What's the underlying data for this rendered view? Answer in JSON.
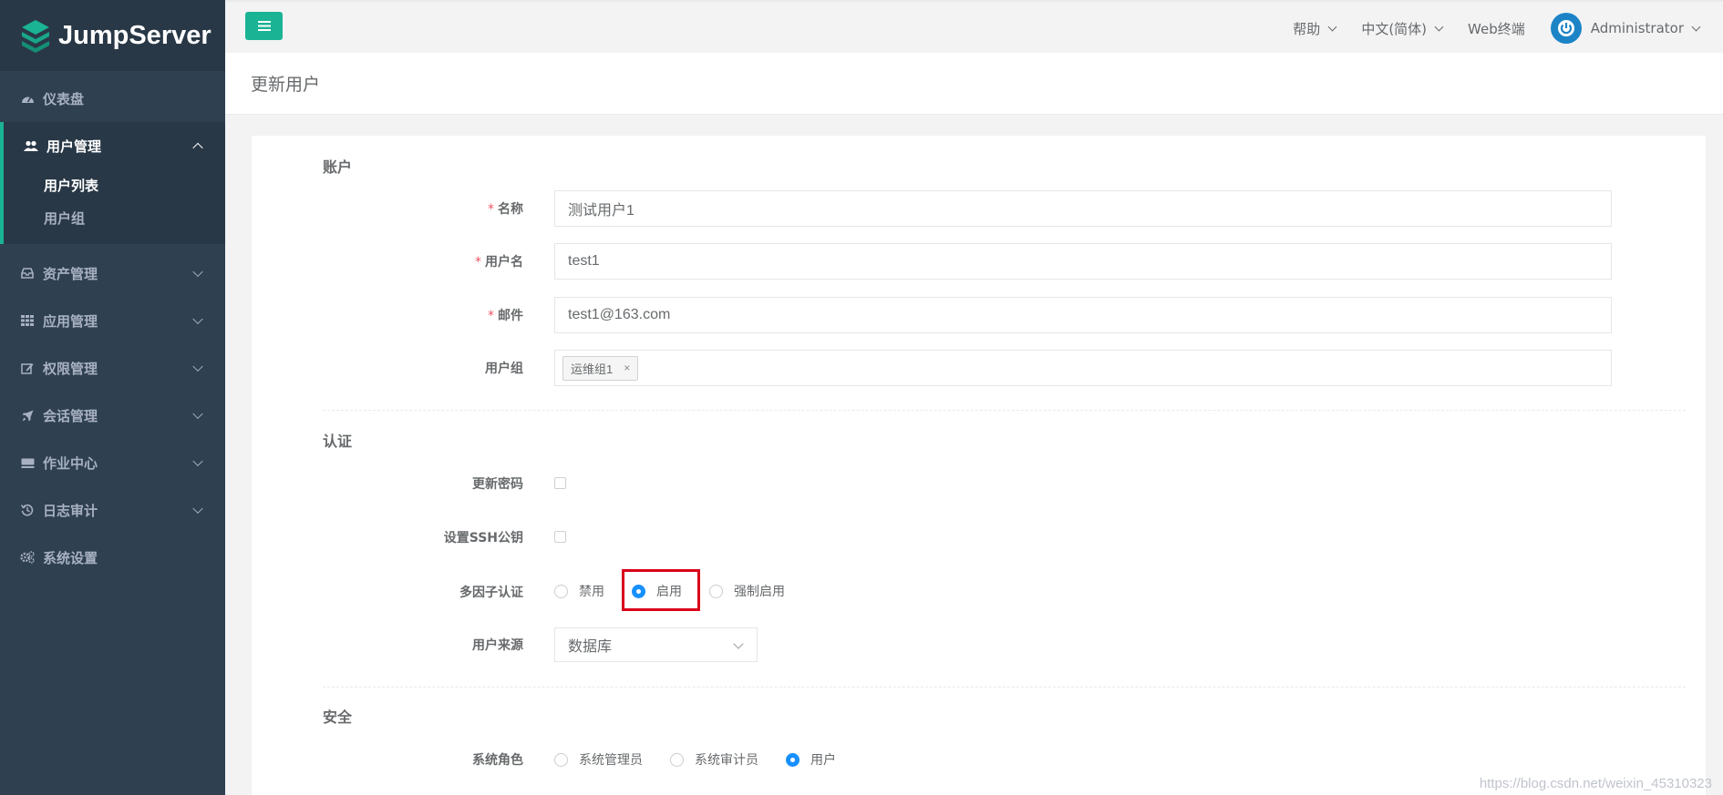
{
  "app": {
    "name": "JumpServer"
  },
  "sidebar": {
    "items": [
      {
        "label": "仪表盘",
        "icon": "dashboard-icon"
      },
      {
        "label": "用户管理",
        "icon": "users-icon",
        "expanded": true,
        "children": [
          {
            "label": "用户列表",
            "active": true
          },
          {
            "label": "用户组"
          }
        ]
      },
      {
        "label": "资产管理",
        "icon": "inbox-icon"
      },
      {
        "label": "应用管理",
        "icon": "grid-icon"
      },
      {
        "label": "权限管理",
        "icon": "edit-icon"
      },
      {
        "label": "会话管理",
        "icon": "rocket-icon"
      },
      {
        "label": "作业中心",
        "icon": "keyboard-icon"
      },
      {
        "label": "日志审计",
        "icon": "history-icon"
      },
      {
        "label": "系统设置",
        "icon": "gears-icon"
      }
    ]
  },
  "topbar": {
    "help": "帮助",
    "language": "中文(简体)",
    "web_terminal": "Web终端",
    "user": "Administrator"
  },
  "page": {
    "title": "更新用户"
  },
  "form": {
    "account_section": "账户",
    "name": {
      "label": "名称",
      "value": "测试用户1"
    },
    "username": {
      "label": "用户名",
      "value": "test1"
    },
    "email": {
      "label": "邮件",
      "value": "test1@163.com"
    },
    "groups": {
      "label": "用户组",
      "tag": "运维组1",
      "tag_remove": "×"
    },
    "auth_section": "认证",
    "update_password": {
      "label": "更新密码",
      "checked": false
    },
    "set_ssh": {
      "label": "设置SSH公钥",
      "checked": false
    },
    "mfa": {
      "label": "多因子认证",
      "options": [
        "禁用",
        "启用",
        "强制启用"
      ],
      "selected": "启用"
    },
    "source": {
      "label": "用户来源",
      "value": "数据库"
    },
    "security_section": "安全",
    "role": {
      "label": "系统角色",
      "options": [
        "系统管理员",
        "系统审计员",
        "用户"
      ],
      "selected": "用户"
    }
  },
  "colors": {
    "sidebar": "#2f4050",
    "accent": "#1ab394",
    "highlight": "#d9001b",
    "radio": "#1890ff"
  },
  "watermark": "https://blog.csdn.net/weixin_45310323"
}
